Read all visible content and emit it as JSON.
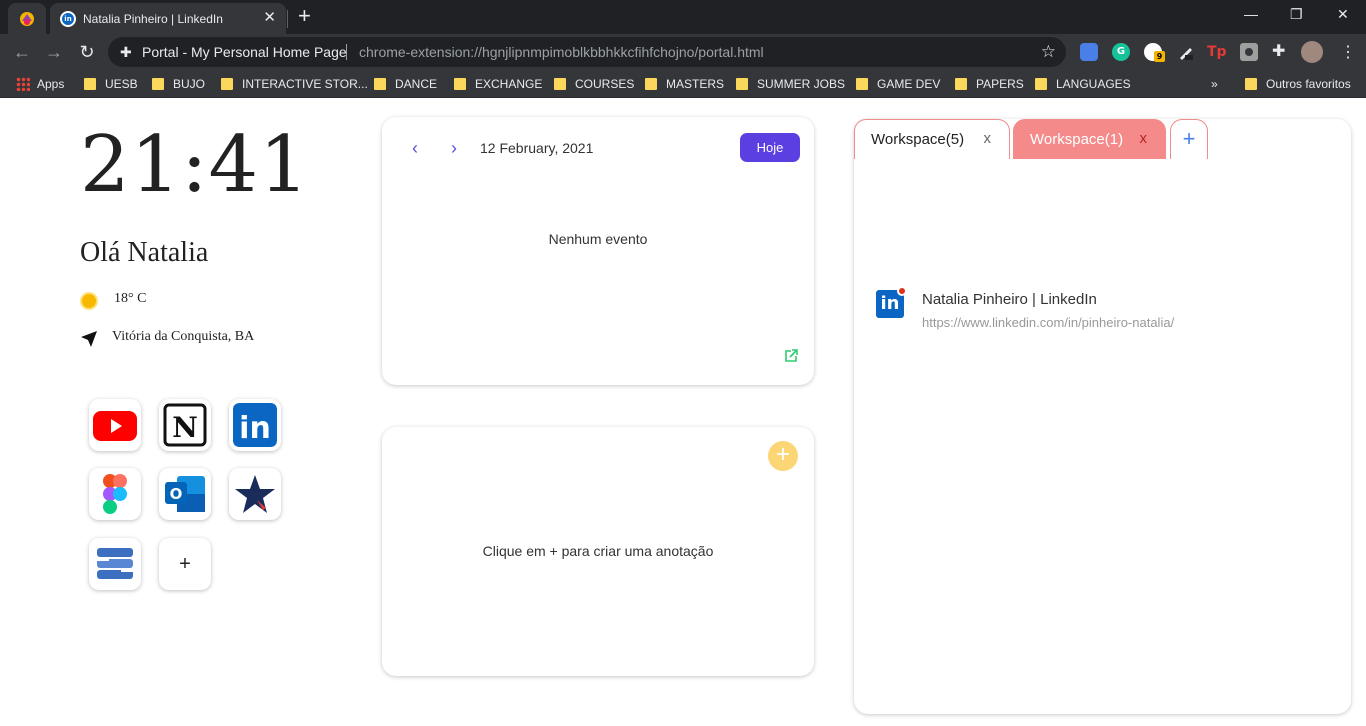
{
  "browser": {
    "tabs": [
      {
        "title": "Natalia Pinheiro | LinkedIn",
        "active": true
      }
    ],
    "omnibox": {
      "title": "Portal - My Personal Home Page",
      "url": "chrome-extension://hgnjlipnmpimoblkbbhkkcfihfchojno/portal.html"
    },
    "extensions": [
      {
        "icon": "shield-blue-icon",
        "color": "#4285f4"
      },
      {
        "icon": "grammarly-icon",
        "color": "#15c39a",
        "label": "G"
      },
      {
        "icon": "extension-badge-icon",
        "color": "#ffffff",
        "badge": "9"
      },
      {
        "icon": "pen-icon",
        "color": "#e8eaed"
      },
      {
        "icon": "tp-icon",
        "color": "#e53935",
        "label": "Tp"
      },
      {
        "icon": "camera-icon",
        "color": "#bdbdbd"
      },
      {
        "icon": "puzzle-icon",
        "color": "#e8eaed"
      },
      {
        "icon": "avatar",
        "color": "#a1887f"
      }
    ],
    "bookmarks": {
      "apps_label": "Apps",
      "items": [
        "UESB",
        "BUJO",
        "INTERACTIVE STOR...",
        "DANCE",
        "EXCHANGE",
        "COURSES",
        "MASTERS",
        "SUMMER JOBS",
        "GAME DEV",
        "PAPERS",
        "LANGUAGES"
      ],
      "more": "»",
      "others": "Outros favoritos"
    }
  },
  "home": {
    "time": "21:41",
    "greeting": "Olá Natalia",
    "temperature": "18° C",
    "location": "Vitória da Conquista, BA",
    "shortcuts": [
      {
        "name": "youtube",
        "label": "YouTube"
      },
      {
        "name": "notion",
        "label": "N"
      },
      {
        "name": "linkedin",
        "label": "in"
      },
      {
        "name": "figma",
        "label": ""
      },
      {
        "name": "outlook",
        "label": "O"
      },
      {
        "name": "star",
        "label": ""
      },
      {
        "name": "s-app",
        "label": "S"
      },
      {
        "name": "add",
        "label": "+"
      }
    ]
  },
  "calendar": {
    "date": "12 February, 2021",
    "today_button": "Hoje",
    "empty_message": "Nenhum evento"
  },
  "notes": {
    "add_button": "+",
    "empty_message": "Clique em + para criar uma anotação"
  },
  "workspace": {
    "tabs": [
      {
        "label": "Workspace(5)",
        "close": "x",
        "active": true
      },
      {
        "label": "Workspace(1)",
        "close": "x",
        "active": false
      }
    ],
    "add_tab": "+",
    "items": [
      {
        "title": "Natalia Pinheiro | LinkedIn",
        "url": "https://www.linkedin.com/in/pinheiro-natalia/"
      }
    ]
  },
  "colors": {
    "accent": "#5b3fe0",
    "workspace_inactive": "#f58a8a",
    "note_add": "#fcd574",
    "linkedin": "#0a66c2"
  }
}
